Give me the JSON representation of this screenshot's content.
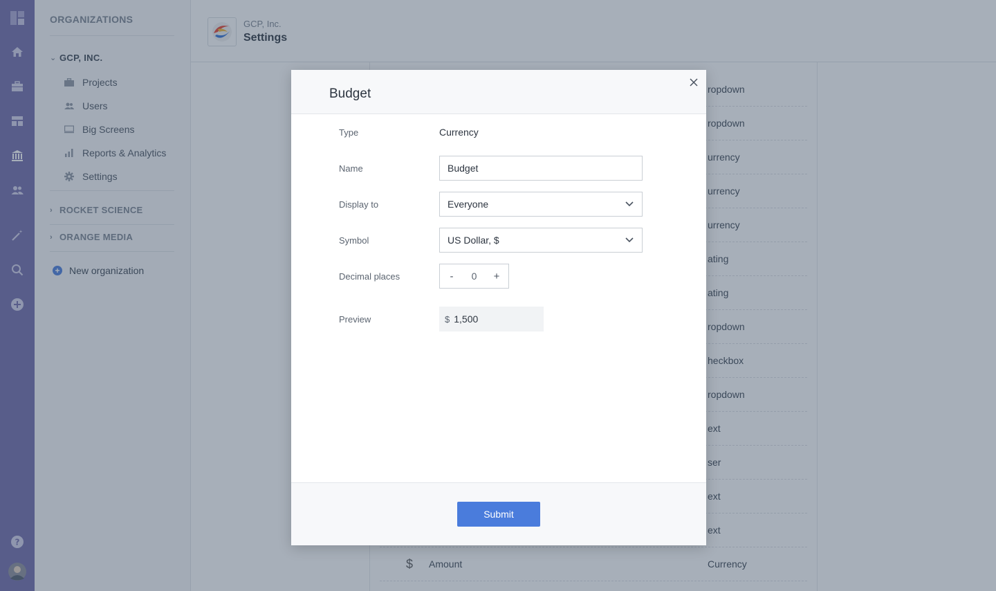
{
  "sidebar": {
    "heading": "ORGANIZATIONS",
    "active_org": "GCP, INC.",
    "items": [
      {
        "label": "Projects",
        "icon": "briefcase-icon"
      },
      {
        "label": "Users",
        "icon": "users-icon"
      },
      {
        "label": "Big Screens",
        "icon": "monitor-icon"
      },
      {
        "label": "Reports & Analytics",
        "icon": "bar-chart-icon"
      },
      {
        "label": "Settings",
        "icon": "gear-icon"
      }
    ],
    "other_orgs": [
      "ROCKET SCIENCE",
      "ORANGE MEDIA"
    ],
    "new_org_label": "New organization"
  },
  "header": {
    "company": "GCP, Inc.",
    "title": "Settings"
  },
  "background_rows": [
    {
      "type": "ropdown"
    },
    {
      "type": "ropdown"
    },
    {
      "type": "urrency"
    },
    {
      "type": "urrency"
    },
    {
      "type": "urrency"
    },
    {
      "type": "ating"
    },
    {
      "type": "ating"
    },
    {
      "type": "ropdown"
    },
    {
      "type": "heckbox"
    },
    {
      "type": "ropdown"
    },
    {
      "type": "ext"
    },
    {
      "type": "ser"
    },
    {
      "type": "ext"
    },
    {
      "type": "ext"
    },
    {
      "icon": "$",
      "name": "Amount",
      "type": "Currency"
    }
  ],
  "modal": {
    "title": "Budget",
    "type_label": "Type",
    "type_value": "Currency",
    "name_label": "Name",
    "name_value": "Budget",
    "display_label": "Display to",
    "display_value": "Everyone",
    "symbol_label": "Symbol",
    "symbol_value": "US Dollar, $",
    "decimal_label": "Decimal places",
    "decimal_minus": "-",
    "decimal_value": "0",
    "decimal_plus": "+",
    "preview_label": "Preview",
    "preview_symbol": "$",
    "preview_value": "1,500",
    "submit_label": "Submit"
  },
  "colors": {
    "rail": "#6f6aaa",
    "accent": "#4a7cdc",
    "overlay": "rgba(60,78,100,0.45)"
  }
}
